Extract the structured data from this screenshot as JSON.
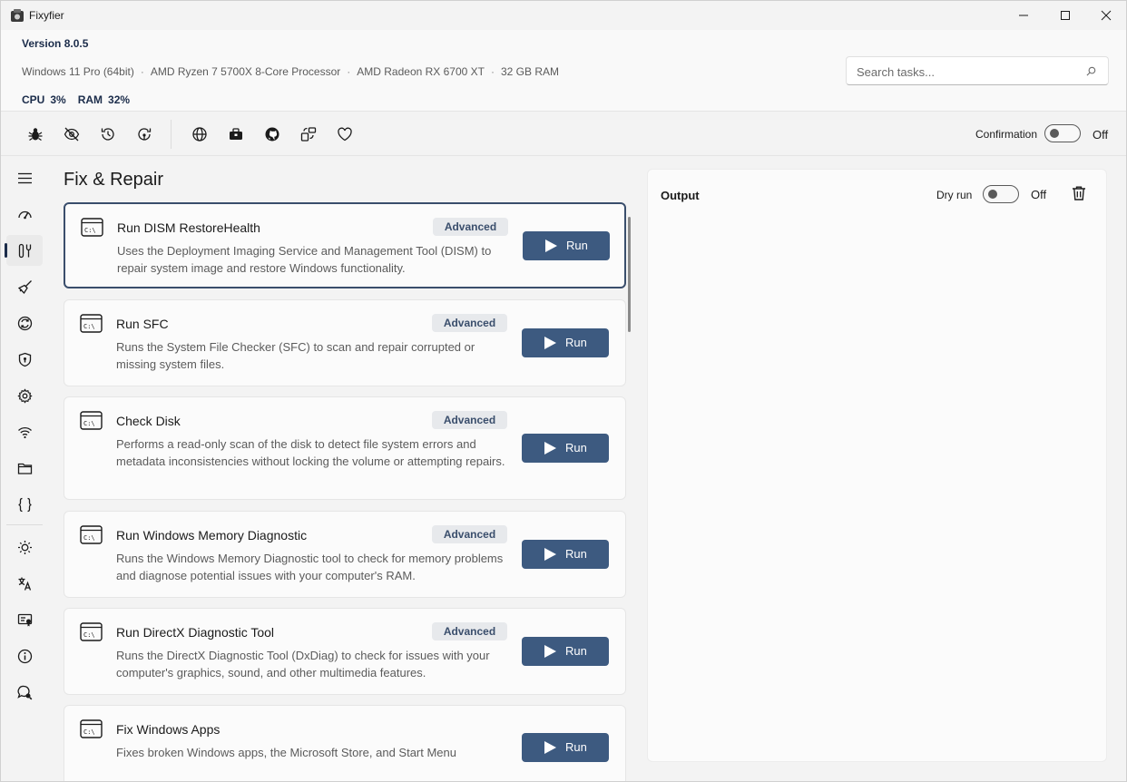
{
  "window": {
    "title": "Fixyfier"
  },
  "header": {
    "version": "Version 8.0.5",
    "sysinfo": [
      "Windows 11 Pro (64bit)",
      "AMD Ryzen 7 5700X 8-Core Processor",
      "AMD Radeon RX 6700 XT",
      "32 GB RAM"
    ],
    "cpu_label": "CPU",
    "cpu_value": "3%",
    "ram_label": "RAM",
    "ram_value": "32%"
  },
  "search": {
    "placeholder": "Search tasks...",
    "value": ""
  },
  "toolbar": {
    "icons": [
      "bug-icon",
      "eye-off-icon",
      "history-icon",
      "restore-icon",
      "globe-icon",
      "toolbox-icon",
      "github-icon",
      "switch-apps-icon",
      "heart-icon"
    ],
    "confirmation_label": "Confirmation",
    "confirmation_state": "Off"
  },
  "sidebar": {
    "items": [
      "menu-icon",
      "speedometer-icon",
      "fix-repair-icon",
      "cleanup-broom-icon",
      "update-sync-icon",
      "security-shield-icon",
      "settings-gear-icon",
      "network-wifi-icon",
      "folder-icon",
      "braces-icon",
      "brightness-icon",
      "language-icon",
      "certificate-icon",
      "info-icon",
      "help-search-icon"
    ],
    "active": "fix-repair-icon"
  },
  "main": {
    "title": "Fix & Repair",
    "tasks": [
      {
        "title": "Run DISM RestoreHealth",
        "badge": "Advanced",
        "description": "Uses the Deployment Imaging Service and Management Tool (DISM) to repair system image and restore Windows functionality.",
        "button": "Run"
      },
      {
        "title": "Run SFC",
        "badge": "Advanced",
        "description": "Runs the System File Checker (SFC) to scan and repair corrupted or missing system files.",
        "button": "Run"
      },
      {
        "title": "Check Disk",
        "badge": "Advanced",
        "description": "Performs a read-only scan of the disk to detect file system errors and metadata inconsistencies without locking the volume or attempting repairs.",
        "button": "Run"
      },
      {
        "title": "Run Windows Memory Diagnostic",
        "badge": "Advanced",
        "description": "Runs the Windows Memory Diagnostic tool to check for memory problems and diagnose potential issues with your computer's RAM.",
        "button": "Run"
      },
      {
        "title": "Run DirectX Diagnostic Tool",
        "badge": "Advanced",
        "description": "Runs the DirectX Diagnostic Tool (DxDiag) to check for issues with your computer's graphics, sound, and other multimedia features.",
        "button": "Run"
      },
      {
        "title": "Fix Windows Apps",
        "badge": "",
        "description": "Fixes broken Windows apps, the Microsoft Store, and Start Menu",
        "button": "Run"
      }
    ]
  },
  "output": {
    "title": "Output",
    "dry_run_label": "Dry run",
    "dry_run_state": "Off"
  },
  "colors": {
    "accent": "#3d5a80",
    "badge_bg": "#e7e9ec",
    "badge_text": "#3a4e6c"
  }
}
